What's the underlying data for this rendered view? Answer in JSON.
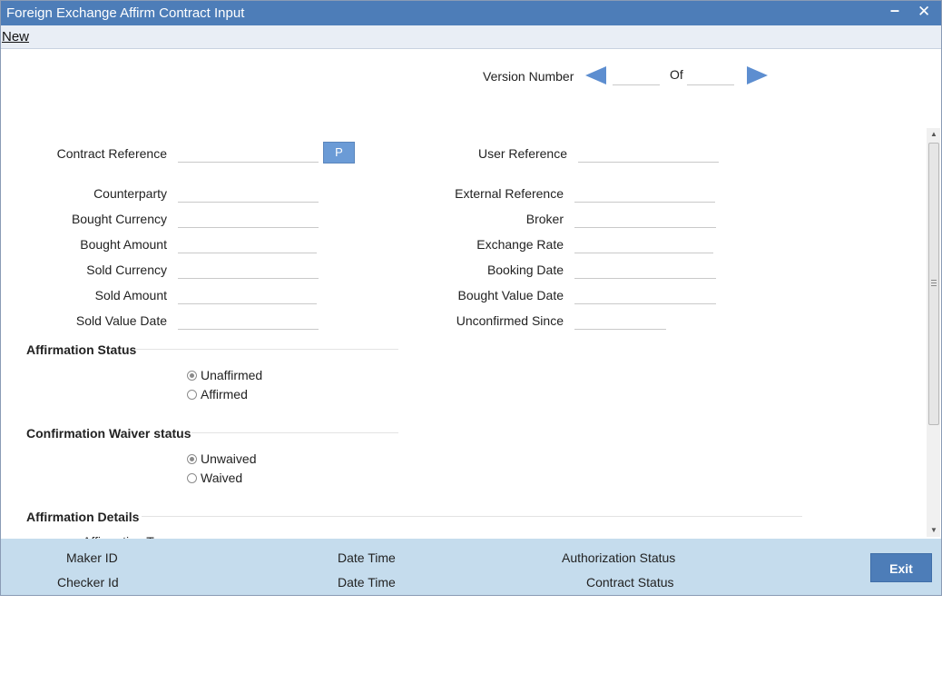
{
  "window": {
    "title": "Foreign Exchange Affirm Contract Input"
  },
  "menu": {
    "new_label": "New"
  },
  "version": {
    "label": "Version Number",
    "of_label": "Of",
    "current": "",
    "total": ""
  },
  "p_button_label": "P",
  "fields_left": [
    {
      "label": "Contract Reference",
      "value": ""
    },
    {
      "label": "Counterparty",
      "value": ""
    },
    {
      "label": "Bought Currency",
      "value": ""
    },
    {
      "label": "Bought Amount",
      "value": ""
    },
    {
      "label": "Sold Currency",
      "value": ""
    },
    {
      "label": "Sold Amount",
      "value": ""
    },
    {
      "label": "Sold Value Date",
      "value": ""
    }
  ],
  "fields_right": [
    {
      "label": "User Reference",
      "value": ""
    },
    {
      "label": "External Reference",
      "value": ""
    },
    {
      "label": "Broker",
      "value": ""
    },
    {
      "label": "Exchange Rate",
      "value": ""
    },
    {
      "label": "Booking Date",
      "value": ""
    },
    {
      "label": "Bought Value Date",
      "value": ""
    },
    {
      "label": "Unconfirmed Since",
      "value": ""
    }
  ],
  "affirmation_status": {
    "title": "Affirmation Status",
    "options": [
      "Unaffirmed",
      "Affirmed"
    ],
    "selected": "Unaffirmed"
  },
  "waiver_status": {
    "title": "Confirmation Waiver status",
    "options": [
      "Unwaived",
      "Waived"
    ],
    "selected": "Unwaived"
  },
  "affirmation_details": {
    "title": "Affirmation Details",
    "partial_label": "Affirmation Type"
  },
  "footer": {
    "maker_id": "Maker ID",
    "checker_id": "Checker Id",
    "date_time_1": "Date Time",
    "date_time_2": "Date Time",
    "authorization_status": "Authorization Status",
    "contract_status": "Contract Status",
    "exit_label": "Exit"
  }
}
